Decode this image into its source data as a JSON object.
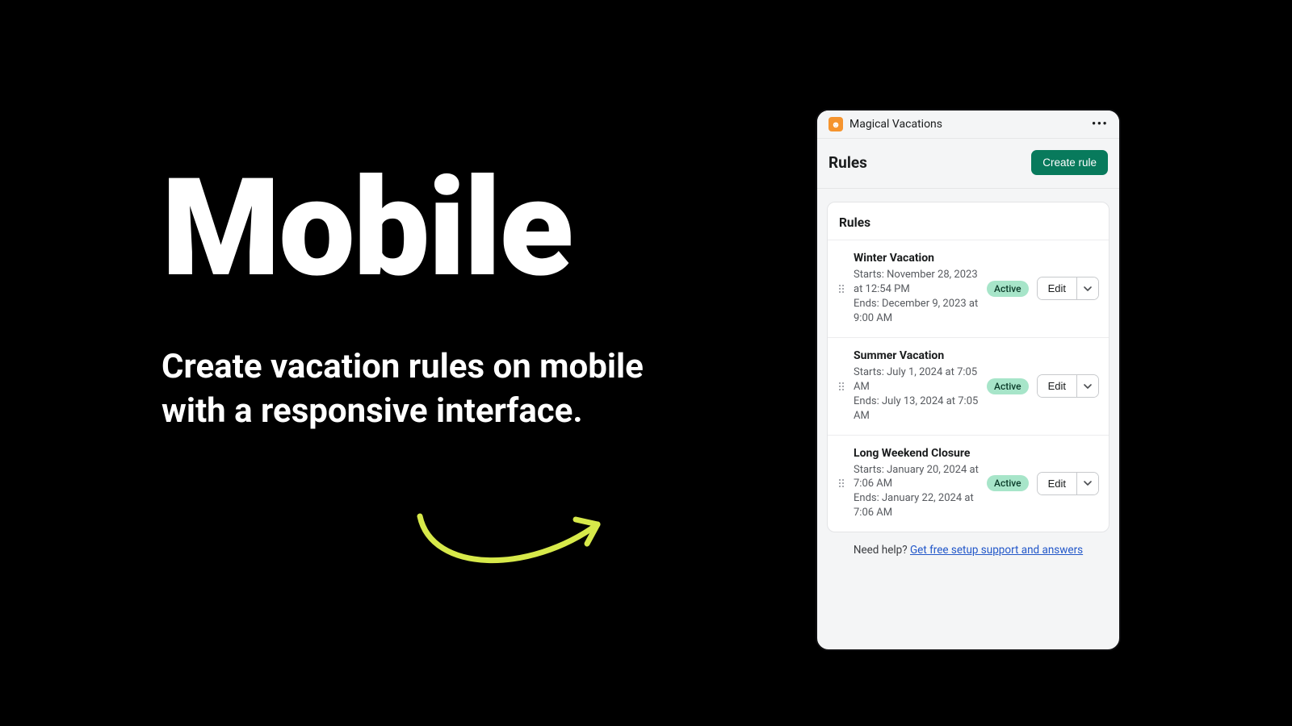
{
  "promo": {
    "headline": "Mobile",
    "subhead": "Create vacation rules on mobile with a responsive interface."
  },
  "app": {
    "name": "Magical Vacations"
  },
  "page": {
    "title": "Rules",
    "create_label": "Create rule",
    "section_title": "Rules"
  },
  "status_label": "Active",
  "edit_label": "Edit",
  "rules": [
    {
      "title": "Winter Vacation",
      "starts": "Starts: November 28, 2023 at 12:54 PM",
      "ends": "Ends: December 9, 2023 at 9:00 AM"
    },
    {
      "title": "Summer Vacation",
      "starts": "Starts: July 1, 2024 at 7:05 AM",
      "ends": "Ends: July 13, 2024 at 7:05 AM"
    },
    {
      "title": "Long Weekend Closure",
      "starts": "Starts: January 20, 2024 at 7:06 AM",
      "ends": "Ends: January 22, 2024 at 7:06 AM"
    }
  ],
  "help": {
    "prefix": "Need help? ",
    "link_text": "Get free setup support and answers"
  },
  "colors": {
    "accent_green": "#087a5c",
    "badge_bg": "#a7e5c9",
    "arrow": "#d7e94a"
  }
}
